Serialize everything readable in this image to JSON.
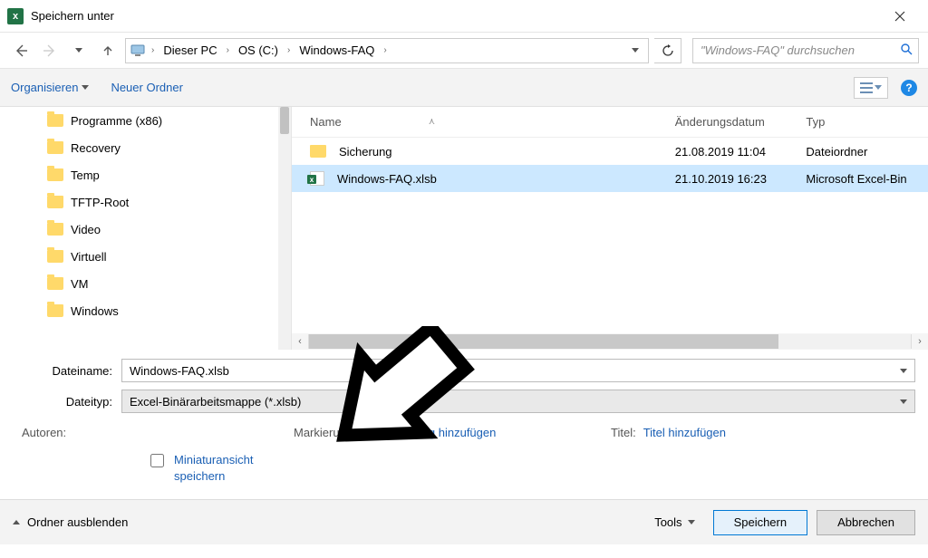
{
  "title": "Speichern unter",
  "breadcrumb": {
    "items": [
      "Dieser PC",
      "OS (C:)",
      "Windows-FAQ"
    ]
  },
  "search": {
    "placeholder": "\"Windows-FAQ\" durchsuchen"
  },
  "cmdbar": {
    "organize": "Organisieren",
    "new_folder": "Neuer Ordner"
  },
  "tree": {
    "items": [
      "Programme (x86)",
      "Recovery",
      "Temp",
      "TFTP-Root",
      "Video",
      "Virtuell",
      "VM",
      "Windows"
    ]
  },
  "columns": {
    "name": "Name",
    "date": "Änderungsdatum",
    "type": "Typ"
  },
  "files": [
    {
      "icon": "folder",
      "name": "Sicherung",
      "date": "21.08.2019 11:04",
      "type": "Dateiordner",
      "selected": false
    },
    {
      "icon": "excel",
      "name": "Windows-FAQ.xlsb",
      "date": "21.10.2019 16:23",
      "type": "Microsoft Excel-Bin",
      "selected": true
    }
  ],
  "form": {
    "filename_label": "Dateiname:",
    "filename_value": "Windows-FAQ.xlsb",
    "filetype_label": "Dateityp:",
    "filetype_value": "Excel-Binärarbeitsmappe (*.xlsb)"
  },
  "meta": {
    "authors_label": "Autoren:",
    "mark_label": "Markierungen:",
    "mark_link": "Markierung hinzufügen",
    "title_label": "Titel:",
    "title_link": "Titel hinzufügen"
  },
  "thumbnail": {
    "label": "Miniaturansicht speichern"
  },
  "footer": {
    "hide": "Ordner ausblenden",
    "tools": "Tools",
    "save": "Speichern",
    "cancel": "Abbrechen"
  }
}
